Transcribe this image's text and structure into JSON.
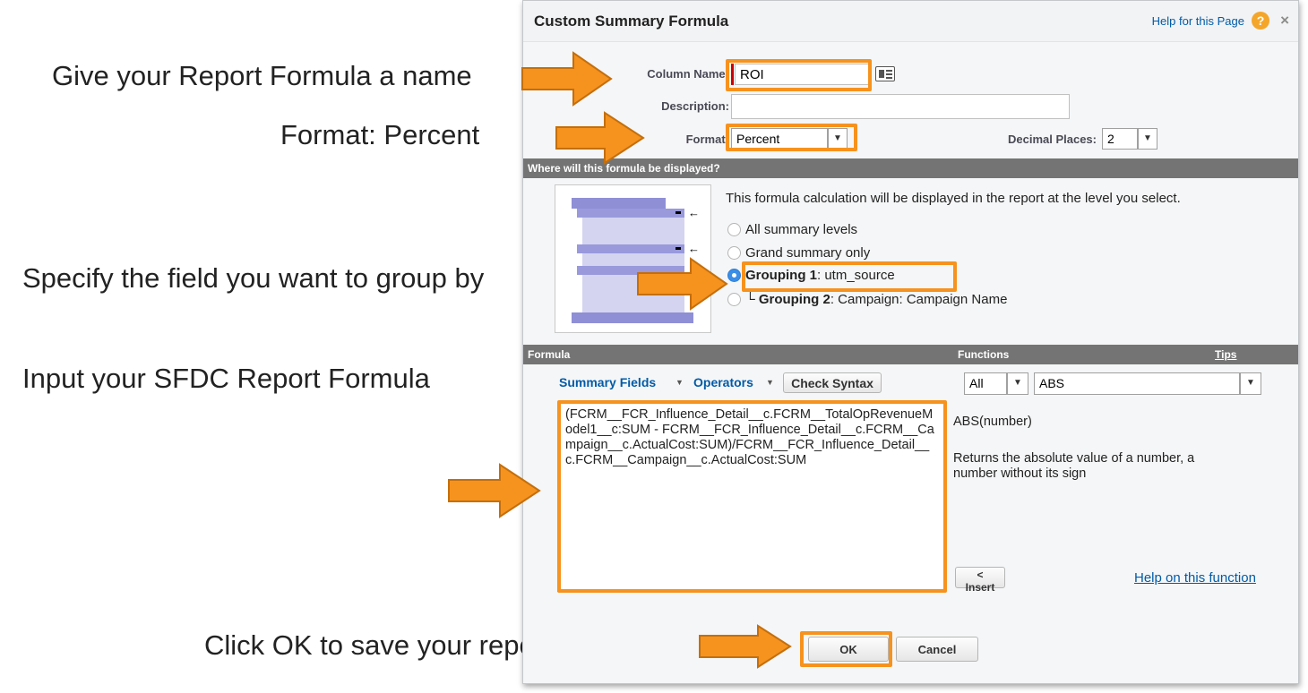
{
  "annotations": {
    "name": "Give your Report Formula a name",
    "format": "Format: Percent",
    "group": "Specify the field you want to group by",
    "formula": "Input your SFDC Report Formula",
    "ok": "Click OK to save your report formula"
  },
  "dialog": {
    "title": "Custom Summary Formula",
    "help_link": "Help for this Page",
    "help_icon": "?",
    "close": "×"
  },
  "fields": {
    "column_name_label": "Column Name:",
    "column_name_value": "ROI",
    "description_label": "Description:",
    "description_value": "",
    "format_label": "Format:",
    "format_value": "Percent",
    "decimal_label": "Decimal Places:",
    "decimal_value": "2"
  },
  "display": {
    "header": "Where will this formula be displayed?",
    "intro": "This formula calculation will be displayed in the report at the level you select.",
    "option_all": "All summary levels",
    "option_grand": "Grand summary only",
    "option_g1_bold": "Grouping 1",
    "option_g1_rest": ": utm_source",
    "option_g2_prefix": "└",
    "option_g2_bold": "Grouping 2",
    "option_g2_rest": ": Campaign: Campaign Name"
  },
  "formula_section": {
    "formula_header": "Formula",
    "functions_header": "Functions",
    "tips": "Tips",
    "summary_fields": "Summary Fields",
    "operators": "Operators",
    "check_syntax": "Check Syntax",
    "category_value": "All",
    "function_value": "ABS",
    "formula_text": "(FCRM__FCR_Influence_Detail__c.FCRM__TotalOpRevenueModel1__c:SUM - FCRM__FCR_Influence_Detail__c.FCRM__Campaign__c.ActualCost:SUM)/FCRM__FCR_Influence_Detail__c.FCRM__Campaign__c.ActualCost:SUM",
    "function_signature": "ABS(number)",
    "function_description": "Returns the absolute value of a number, a number without its sign",
    "insert_button": "< Insert",
    "help_function": "Help on this function"
  },
  "buttons": {
    "ok": "OK",
    "cancel": "Cancel"
  },
  "colors": {
    "highlight": "#f6921e",
    "link": "#015ba7",
    "section_bar": "#747474"
  }
}
